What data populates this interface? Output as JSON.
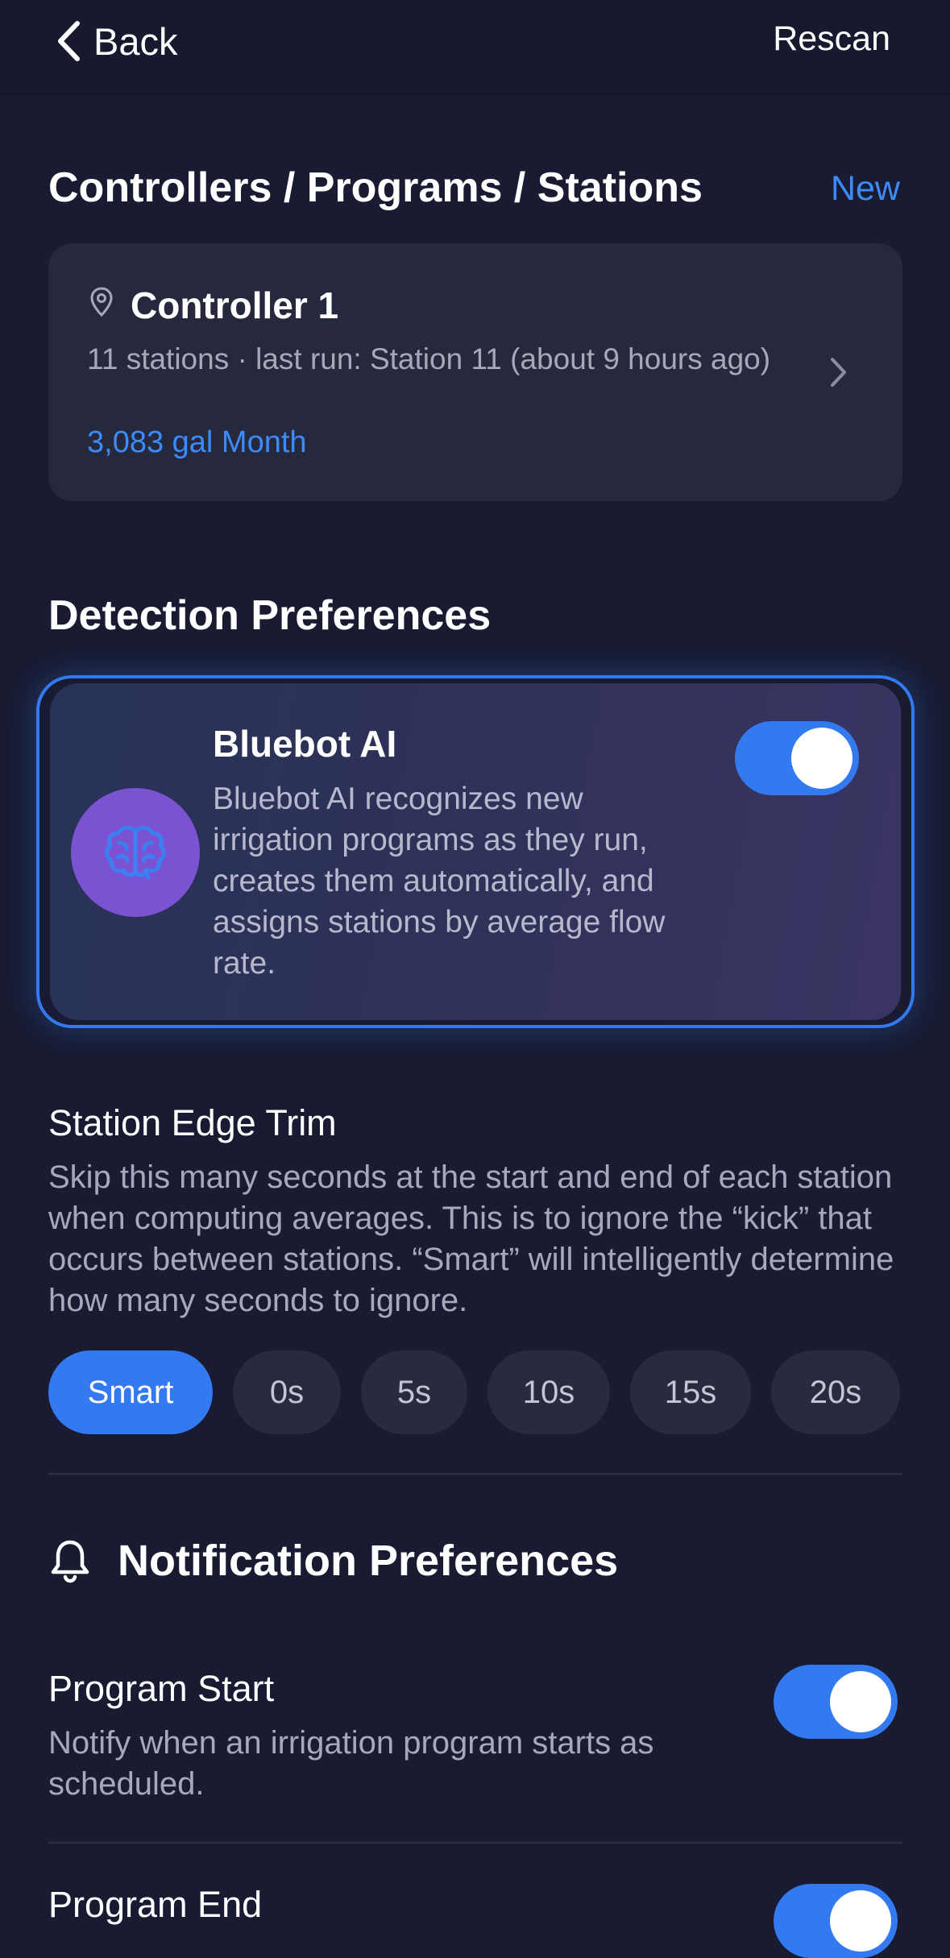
{
  "header": {
    "back_label": "Back",
    "rescan_label": "Rescan"
  },
  "controllers_section": {
    "title": "Controllers / Programs / Stations",
    "new_label": "New",
    "controller": {
      "name": "Controller 1",
      "meta": "11 stations · last run: Station 11 (about 9 hours ago)",
      "usage": "3,083 gal Month"
    }
  },
  "detection": {
    "title": "Detection Preferences",
    "ai": {
      "title": "Bluebot AI",
      "description": "Bluebot AI recognizes new irrigation programs as they run, creates them automatically, and assigns stations by average flow rate.",
      "enabled": true
    }
  },
  "edge_trim": {
    "title": "Station Edge Trim",
    "description": "Skip this many seconds at the start and end of each station when computing averages. This is to ignore the “kick” that occurs between stations. “Smart” will intelligently determine how many seconds to ignore.",
    "options": [
      "Smart",
      "0s",
      "5s",
      "10s",
      "15s",
      "20s"
    ],
    "selected": "Smart"
  },
  "notifications": {
    "title": "Notification Preferences",
    "items": [
      {
        "title": "Program Start",
        "description": "Notify when an irrigation program starts as scheduled.",
        "enabled": true
      },
      {
        "title": "Program End",
        "description": "",
        "enabled": true
      }
    ]
  },
  "colors": {
    "accent": "#3379ef",
    "link": "#3d8bf8",
    "background": "#181b31",
    "card": "#26283d",
    "avatar": "#7a52d2"
  }
}
